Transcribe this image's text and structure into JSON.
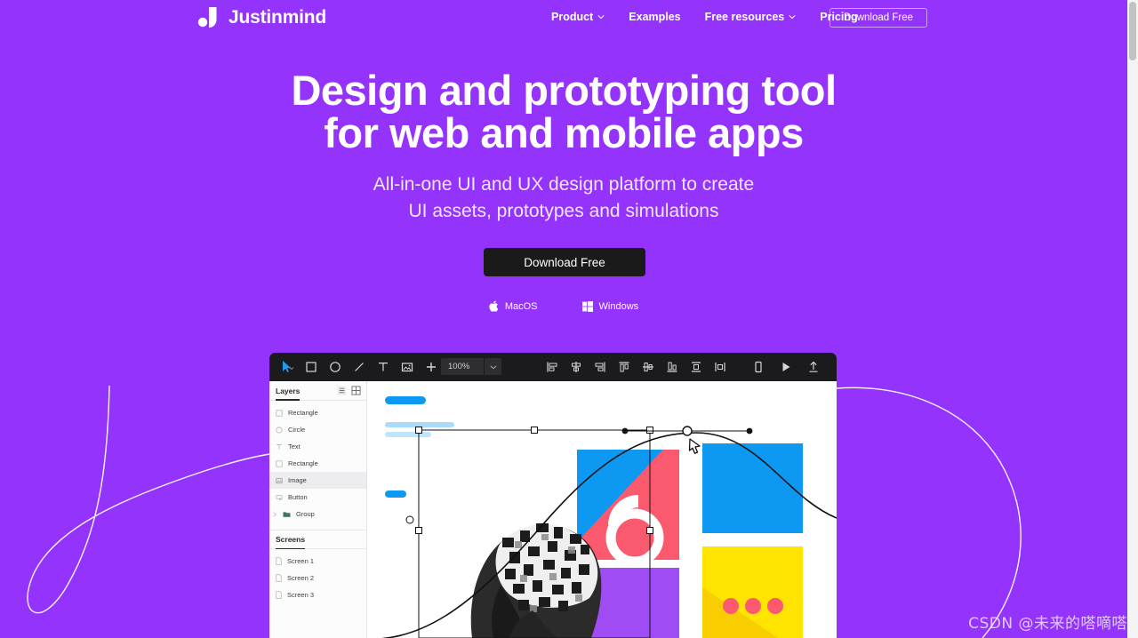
{
  "theme": {
    "background_purple": "#9333fb",
    "cta_dark": "#1a1a1a",
    "accent_blue": "#0d99f2",
    "accent_pink": "#fb5a6e",
    "accent_yellow": "#ffe400",
    "accent_purple_card": "#a04cf5",
    "app_chrome_dark": "#1b1b1d"
  },
  "nav": {
    "logo_text": "Justinmind",
    "links": [
      {
        "label": "Product",
        "has_chevron": true
      },
      {
        "label": "Examples",
        "has_chevron": false
      },
      {
        "label": "Free resources",
        "has_chevron": true
      },
      {
        "label": "Pricing",
        "has_chevron": false
      }
    ],
    "download_button": "Download Free"
  },
  "hero": {
    "headline_line1": "Design and prototyping tool",
    "headline_line2": "for web and mobile apps",
    "subtitle_line1": "All-in-one UI and UX design platform to create",
    "subtitle_line2": "UI assets, prototypes and simulations",
    "cta_label": "Download Free",
    "os_options": [
      {
        "label": "MacOS",
        "icon": "apple-icon"
      },
      {
        "label": "Windows",
        "icon": "windows-icon"
      }
    ]
  },
  "app": {
    "toolbar": {
      "left_tools": [
        {
          "name": "select-tool",
          "icon": "cursor-icon"
        },
        {
          "name": "rectangle-tool",
          "icon": "square-icon"
        },
        {
          "name": "ellipse-tool",
          "icon": "circle-icon"
        },
        {
          "name": "line-tool",
          "icon": "line-icon"
        },
        {
          "name": "text-tool",
          "icon": "text-icon"
        },
        {
          "name": "image-tool",
          "icon": "image-icon"
        },
        {
          "name": "add-tool",
          "icon": "plus-icon"
        }
      ],
      "zoom_value": "100%",
      "align_tools": [
        {
          "name": "align-left",
          "icon": "align-left-icon"
        },
        {
          "name": "align-center-horizontal",
          "icon": "align-center-h-icon"
        },
        {
          "name": "align-right",
          "icon": "align-right-icon"
        },
        {
          "name": "align-top",
          "icon": "align-top-icon"
        },
        {
          "name": "align-middle-vertical",
          "icon": "align-middle-v-icon"
        },
        {
          "name": "align-bottom",
          "icon": "align-bottom-icon"
        },
        {
          "name": "distribute-vertical",
          "icon": "distribute-v-icon"
        },
        {
          "name": "distribute-horizontal",
          "icon": "distribute-h-icon"
        }
      ],
      "right_tools": [
        {
          "name": "device-preview",
          "icon": "phone-icon"
        },
        {
          "name": "play-simulation",
          "icon": "play-icon"
        },
        {
          "name": "share-publish",
          "icon": "upload-icon"
        }
      ]
    },
    "layers_panel": {
      "title": "Layers",
      "header_icons": [
        {
          "name": "list-view-icon"
        },
        {
          "name": "grid-view-icon"
        }
      ],
      "items": [
        {
          "label": "Rectangle",
          "icon": "square-icon",
          "selected": false
        },
        {
          "label": "Circle",
          "icon": "circle-icon",
          "selected": false
        },
        {
          "label": "Text",
          "icon": "text-icon",
          "selected": false
        },
        {
          "label": "Rectangle",
          "icon": "square-icon",
          "selected": false
        },
        {
          "label": "Image",
          "icon": "image-icon",
          "selected": true
        },
        {
          "label": "Button",
          "icon": "button-icon",
          "selected": false
        },
        {
          "label": "Group",
          "icon": "folder-icon",
          "selected": false
        }
      ]
    },
    "screens_panel": {
      "title": "Screens",
      "items": [
        {
          "label": "Screen 1",
          "icon": "document-icon"
        },
        {
          "label": "Screen 2",
          "icon": "document-icon"
        },
        {
          "label": "Screen 3",
          "icon": "document-icon"
        }
      ]
    },
    "canvas": {
      "cursor": "pen-tool-cursor",
      "shapes": [
        {
          "name": "blue-bar-top",
          "color": "#0d99f2"
        },
        {
          "name": "light-blue-bar-1",
          "color": "#a9dcfb"
        },
        {
          "name": "light-blue-bar-2",
          "color": "#bfe5fc"
        },
        {
          "name": "blue-bar-small",
          "color": "#0d99f2"
        },
        {
          "name": "pink-card",
          "color": "#fb5a6e"
        },
        {
          "name": "blue-card-left",
          "color": "#0d99f2"
        },
        {
          "name": "purple-card",
          "color": "#a04cf5"
        },
        {
          "name": "blue-card-right",
          "color": "#0d99f2"
        },
        {
          "name": "yellow-card",
          "color": "#ffe400"
        },
        {
          "name": "pink-dot",
          "color": "#fb5a6e"
        }
      ]
    }
  },
  "watermark": "CSDN @未来的嗒嘀嗒"
}
